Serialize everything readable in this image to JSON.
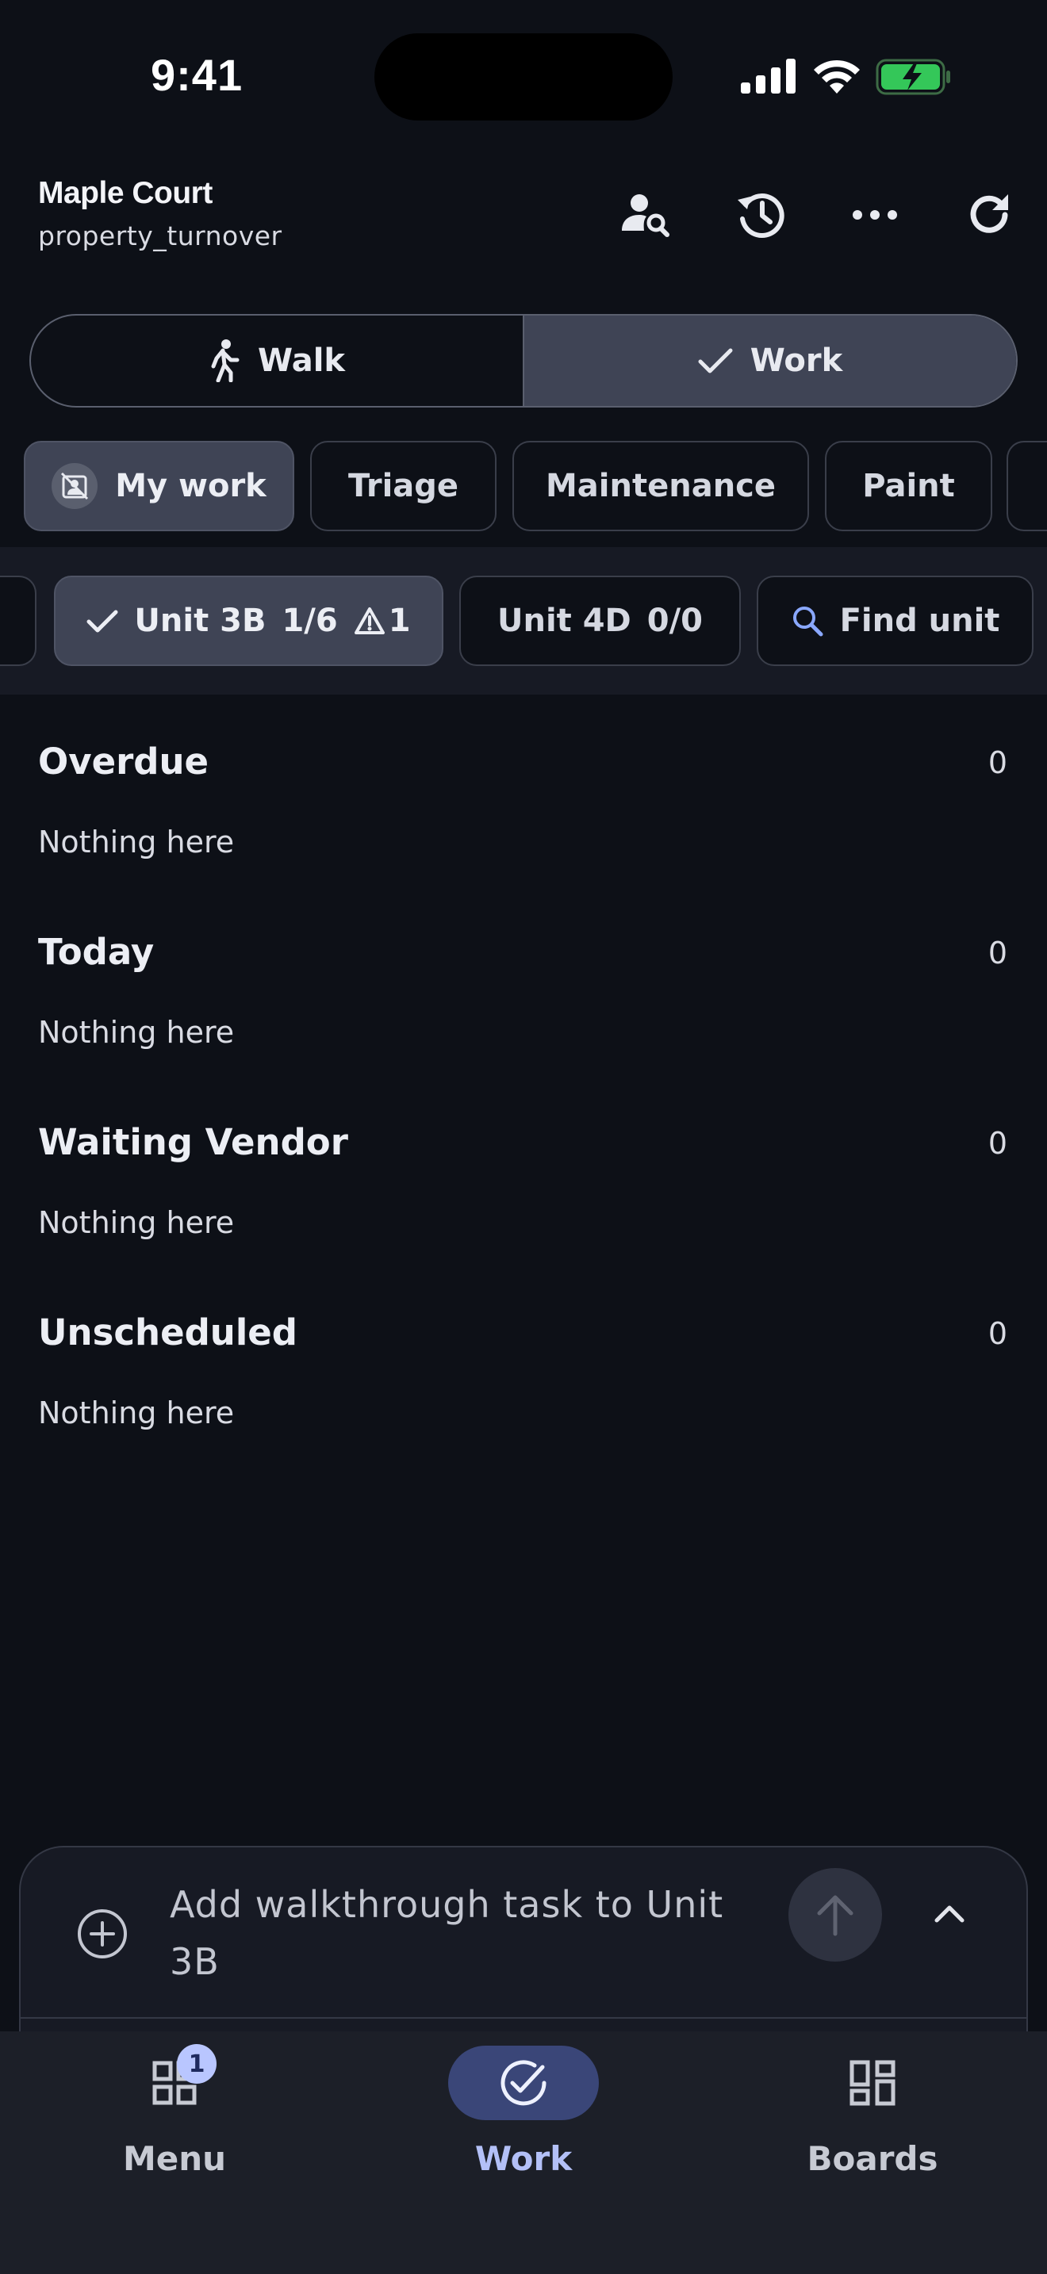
{
  "status": {
    "time": "9:41"
  },
  "header": {
    "title": "Maple Court",
    "subtitle": "property_turnover",
    "icons": [
      "person-search-icon",
      "history-icon",
      "more-icon",
      "refresh-icon"
    ]
  },
  "segment": {
    "walk_label": "Walk",
    "work_label": "Work",
    "selected": "Work"
  },
  "chips": [
    {
      "label": "My work",
      "icon": "assignment-person-icon",
      "active": true
    },
    {
      "label": "Triage",
      "active": false
    },
    {
      "label": "Maintenance",
      "active": false
    },
    {
      "label": "Paint",
      "active": false
    }
  ],
  "units": {
    "active": {
      "name": "Unit 3B",
      "progress": "1/6",
      "alerts": "1"
    },
    "other": {
      "name": "Unit 4D",
      "progress": "0/0"
    },
    "find_label": "Find unit"
  },
  "sections": [
    {
      "title": "Overdue",
      "count": "0",
      "empty": "Nothing here"
    },
    {
      "title": "Today",
      "count": "0",
      "empty": "Nothing here"
    },
    {
      "title": "Waiting Vendor",
      "count": "0",
      "empty": "Nothing here"
    },
    {
      "title": "Unscheduled",
      "count": "0",
      "empty": "Nothing here"
    }
  ],
  "composer": {
    "placeholder": "Add walkthrough task to Unit 3B"
  },
  "nav": [
    {
      "label": "Menu",
      "icon": "grid-icon",
      "badge": "1",
      "active": false
    },
    {
      "label": "Work",
      "icon": "check-circle-icon",
      "active": true
    },
    {
      "label": "Boards",
      "icon": "dashboard-icon",
      "active": false
    }
  ],
  "colors": {
    "background": "#0d1017",
    "accent": "#3a4678",
    "accent_text": "#b3c0f7",
    "battery": "#34c759"
  }
}
